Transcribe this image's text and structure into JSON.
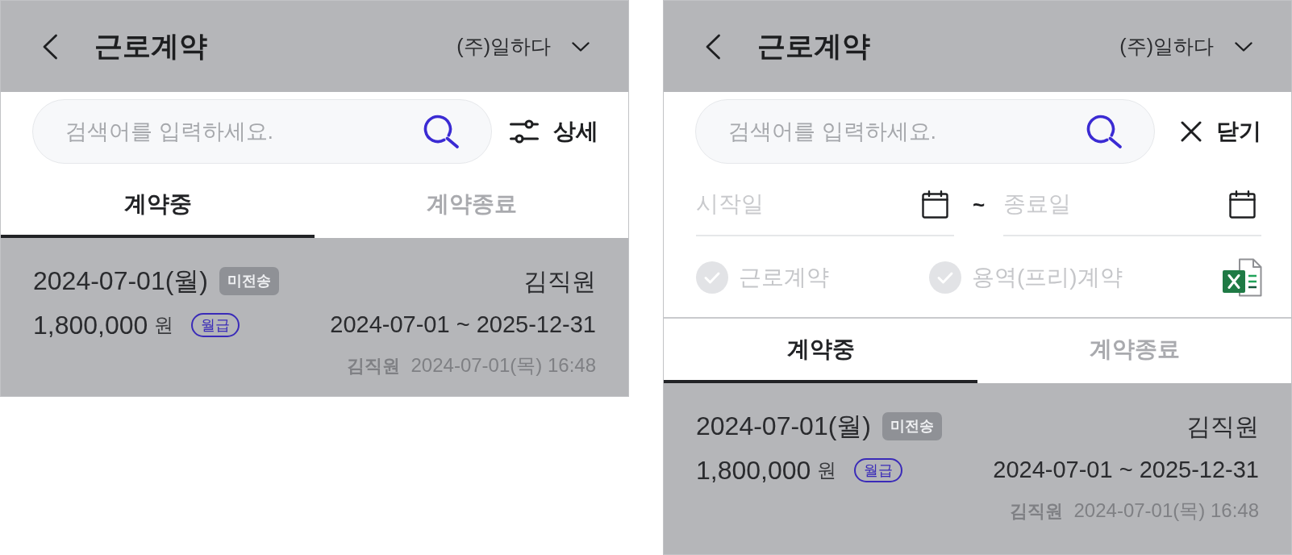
{
  "panels": [
    {
      "header": {
        "title": "근로계약",
        "company": "(주)일하다"
      },
      "search": {
        "placeholder": "검색어를 입력하세요."
      },
      "filter_toggle": {
        "kind": "detail",
        "label": "상세"
      },
      "tabs": [
        {
          "label": "계약중",
          "selected": true
        },
        {
          "label": "계약종료",
          "selected": false
        }
      ],
      "contracts": [
        {
          "date": "2024-07-01(월)",
          "status": "미전송",
          "employee": "김직원",
          "amount": "1,800,000",
          "unit": "원",
          "pay_type": "월급",
          "period": "2024-07-01 ~ 2025-12-31",
          "author": "김직원",
          "created_at": "2024-07-01(목) 16:48"
        }
      ]
    },
    {
      "header": {
        "title": "근로계약",
        "company": "(주)일하다"
      },
      "search": {
        "placeholder": "검색어를 입력하세요."
      },
      "filter_toggle": {
        "kind": "close",
        "label": "닫기"
      },
      "filters": {
        "start_date": {
          "placeholder": "시작일"
        },
        "separator": "~",
        "end_date": {
          "placeholder": "종료일"
        },
        "contract_types": [
          {
            "label": "근로계약",
            "checked": false
          },
          {
            "label": "용역(프리)계약",
            "checked": false
          }
        ]
      },
      "tabs": [
        {
          "label": "계약중",
          "selected": true
        },
        {
          "label": "계약종료",
          "selected": false
        }
      ],
      "contracts": [
        {
          "date": "2024-07-01(월)",
          "status": "미전송",
          "employee": "김직원",
          "amount": "1,800,000",
          "unit": "원",
          "pay_type": "월급",
          "period": "2024-07-01 ~ 2025-12-31",
          "author": "김직원",
          "created_at": "2024-07-01(목) 16:48"
        }
      ]
    }
  ]
}
